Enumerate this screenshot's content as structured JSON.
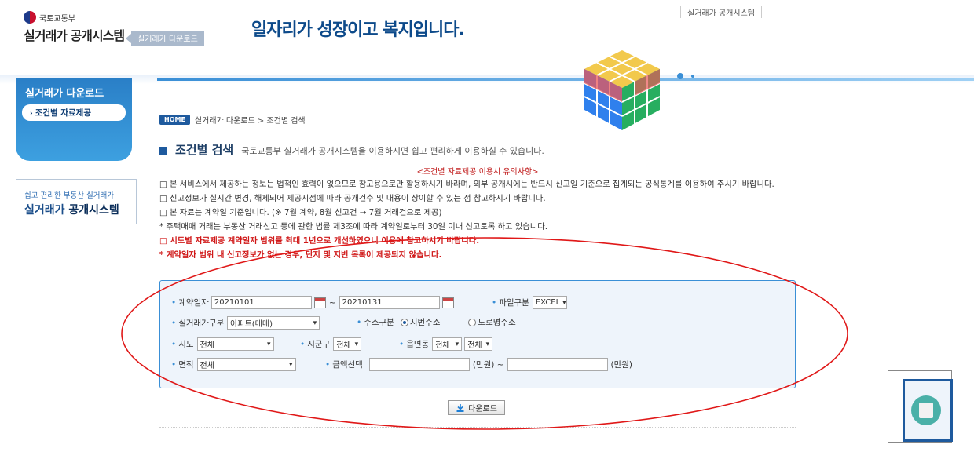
{
  "header": {
    "ministry": "국토교통부",
    "system_name": "실거래가 공개시스템",
    "crumb_tag": "실거래가 다운로드",
    "slogan": "일자리가 성장이고 복지입니다.",
    "top_link": "실거래가 공개시스템"
  },
  "sidebar": {
    "title": "실거래가 다운로드",
    "items": [
      {
        "label": "조건별 자료제공"
      }
    ],
    "promo_line1": "쉽고 편리한 부동산 실거래가",
    "promo_line2a": "실거래가 ",
    "promo_line2b": "공개시스템"
  },
  "breadcrumb": {
    "home": "HOME",
    "path": "실거래가 다운로드 > 조건별 검색"
  },
  "section": {
    "title": "조건별 검색",
    "description": "국토교통부 실거래가 공개시스템을 이용하시면 쉽고 편리하게 이용하실 수 있습니다."
  },
  "notices": {
    "title": "<조건별 자료제공 이용시 유의사항>",
    "items": [
      "□ 본 서비스에서 제공하는 정보는 법적인 효력이 없으므로 참고용으로만 활용하시기 바라며, 외부 공개시에는 반드시 신고일 기준으로 집계되는 공식통계를 이용하여 주시기 바랍니다.",
      "□ 신고정보가 실시간 변경, 해제되어 제공시점에 따라 공개건수 및 내용이 상이할 수 있는 점 참고하시기 바랍니다.",
      "□ 본 자료는 계약일 기준입니다. (※ 7월 계약, 8월 신고건 → 7월 거래건으로 제공)",
      "* 주택매매 거래는 부동산 거래신고 등에 관한 법률 제3조에 따라 계약일로부터 30일 이내 신고토록 하고 있습니다."
    ],
    "red_items": [
      "□ 시도별 자료제공 계약일자 범위를 최대 1년으로 개선하였으니 이용에 참고하시기 바랍니다.",
      "* 계약일자 범위 내 신고정보가 없는 경우, 단지 및 지번 목록이 제공되지 않습니다."
    ]
  },
  "form": {
    "contract_date_label": "계약일자",
    "date_from": "20210101",
    "tilde": "~",
    "date_to": "20210131",
    "file_type_label": "파일구분",
    "file_type_value": "EXCEL",
    "trade_type_label": "실거래가구분",
    "trade_type_value": "아파트(매매)",
    "address_type_label": "주소구분",
    "address_option_1": "지번주소",
    "address_option_2": "도로명주소",
    "sido_label": "시도",
    "sido_value": "전체",
    "sigungu_label": "시군구",
    "sigungu_value": "전체",
    "emd_label": "읍면동",
    "emd_value": "전체",
    "emd_value2": "전체",
    "area_label": "면적",
    "area_value": "전체",
    "amount_label": "금액선택",
    "amount_unit_1": "(만원) ~",
    "amount_unit_2": "(만원)",
    "download_label": "다운로드"
  },
  "colors": {
    "brand": "#1e5a9e",
    "accent": "#3a8fd6",
    "warning": "#d01818"
  }
}
